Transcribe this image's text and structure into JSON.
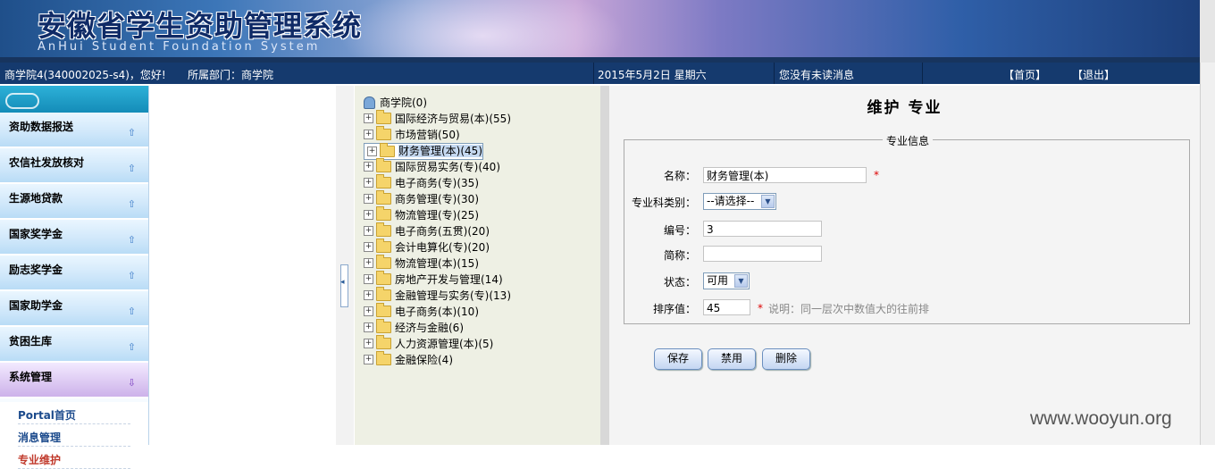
{
  "banner": {
    "title": "安徽省学生资助管理系统",
    "subtitle": "AnHui Student Foundation System"
  },
  "infobar": {
    "user": "商学院4(340002025-s4)，您好!",
    "department": "所属部门：商学院",
    "date": "2015年5月2日  星期六",
    "messages": "您没有未读消息",
    "home": "【首页】",
    "logout": "【退出】"
  },
  "menu": {
    "items": [
      {
        "label": "资助数据报送"
      },
      {
        "label": "农信社发放核对"
      },
      {
        "label": "生源地贷款"
      },
      {
        "label": "国家奖学金"
      },
      {
        "label": "励志奖学金"
      },
      {
        "label": "国家助学金"
      },
      {
        "label": "贫困生库"
      },
      {
        "label": "系统管理"
      }
    ],
    "subitems": [
      {
        "label": "Portal首页"
      },
      {
        "label": "消息管理"
      },
      {
        "label": "专业维护"
      }
    ]
  },
  "tree": {
    "root": "商学院(0)",
    "nodes": [
      {
        "label": "国际经济与贸易(本)(55)"
      },
      {
        "label": "市场营销(50)"
      },
      {
        "label": "财务管理(本)(45)"
      },
      {
        "label": "国际贸易实务(专)(40)"
      },
      {
        "label": "电子商务(专)(35)"
      },
      {
        "label": "商务管理(专)(30)"
      },
      {
        "label": "物流管理(专)(25)"
      },
      {
        "label": "电子商务(五贯)(20)"
      },
      {
        "label": "会计电算化(专)(20)"
      },
      {
        "label": "物流管理(本)(15)"
      },
      {
        "label": "房地产开发与管理(14)"
      },
      {
        "label": "金融管理与实务(专)(13)"
      },
      {
        "label": "电子商务(本)(10)"
      },
      {
        "label": "经济与金融(6)"
      },
      {
        "label": "人力资源管理(本)(5)"
      },
      {
        "label": "金融保险(4)"
      }
    ]
  },
  "form": {
    "title": "维护 专业",
    "legend": "专业信息",
    "name_label": "名称：",
    "name_value": "财务管理(本)",
    "category_label": "专业科类别：",
    "category_value": "--请选择--",
    "code_label": "编号：",
    "code_value": "3",
    "short_label": "简称：",
    "short_value": "",
    "status_label": "状态：",
    "status_value": "可用",
    "order_label": "排序值：",
    "order_value": "45",
    "required_mark": "*",
    "order_hint": "说明：同一层次中数值大的往前排"
  },
  "buttons": {
    "save": "保存",
    "disable": "禁用",
    "delete": "删除"
  },
  "watermark": "www.wooyun.org"
}
